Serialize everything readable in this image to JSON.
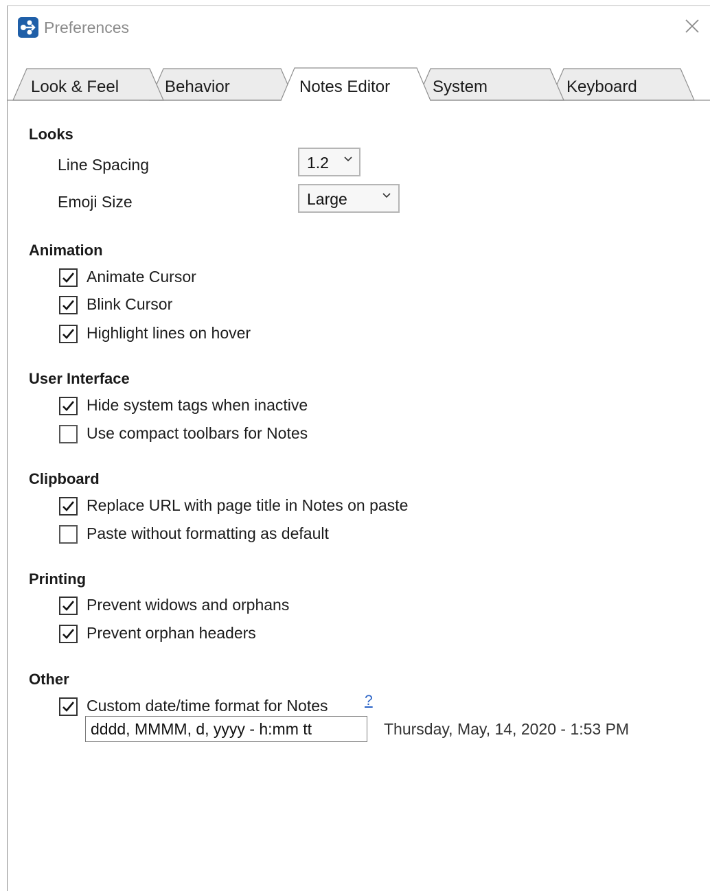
{
  "window": {
    "title": "Preferences"
  },
  "tabs": [
    {
      "label": "Look & Feel",
      "active": false
    },
    {
      "label": "Behavior",
      "active": false
    },
    {
      "label": "Notes Editor",
      "active": true
    },
    {
      "label": "System",
      "active": false
    },
    {
      "label": "Keyboard",
      "active": false
    }
  ],
  "looks": {
    "title": "Looks",
    "line_spacing": {
      "label": "Line Spacing",
      "value": "1.2"
    },
    "emoji_size": {
      "label": "Emoji Size",
      "value": "Large"
    }
  },
  "animation": {
    "title": "Animation",
    "items": [
      {
        "label": "Animate Cursor",
        "checked": true
      },
      {
        "label": "Blink Cursor",
        "checked": true
      },
      {
        "label": "Highlight lines on hover",
        "checked": true
      }
    ]
  },
  "user_interface": {
    "title": "User Interface",
    "items": [
      {
        "label": "Hide system tags when inactive",
        "checked": true
      },
      {
        "label": "Use compact toolbars for Notes",
        "checked": false
      }
    ]
  },
  "clipboard": {
    "title": "Clipboard",
    "items": [
      {
        "label": "Replace URL with page title in Notes on paste",
        "checked": true
      },
      {
        "label": "Paste without formatting as default",
        "checked": false
      }
    ]
  },
  "printing": {
    "title": "Printing",
    "items": [
      {
        "label": "Prevent widows and orphans",
        "checked": true
      },
      {
        "label": "Prevent orphan headers",
        "checked": true
      }
    ]
  },
  "other": {
    "title": "Other",
    "custom_format": {
      "label": "Custom date/time format for Notes",
      "checked": true
    },
    "help_link": "?",
    "format_value": "dddd, MMMM, d, yyyy - h:mm tt",
    "preview": "Thursday, May, 14, 2020 - 1:53 PM"
  },
  "colors": {
    "link": "#2a63c6",
    "app_icon": "#1f5fa8"
  }
}
